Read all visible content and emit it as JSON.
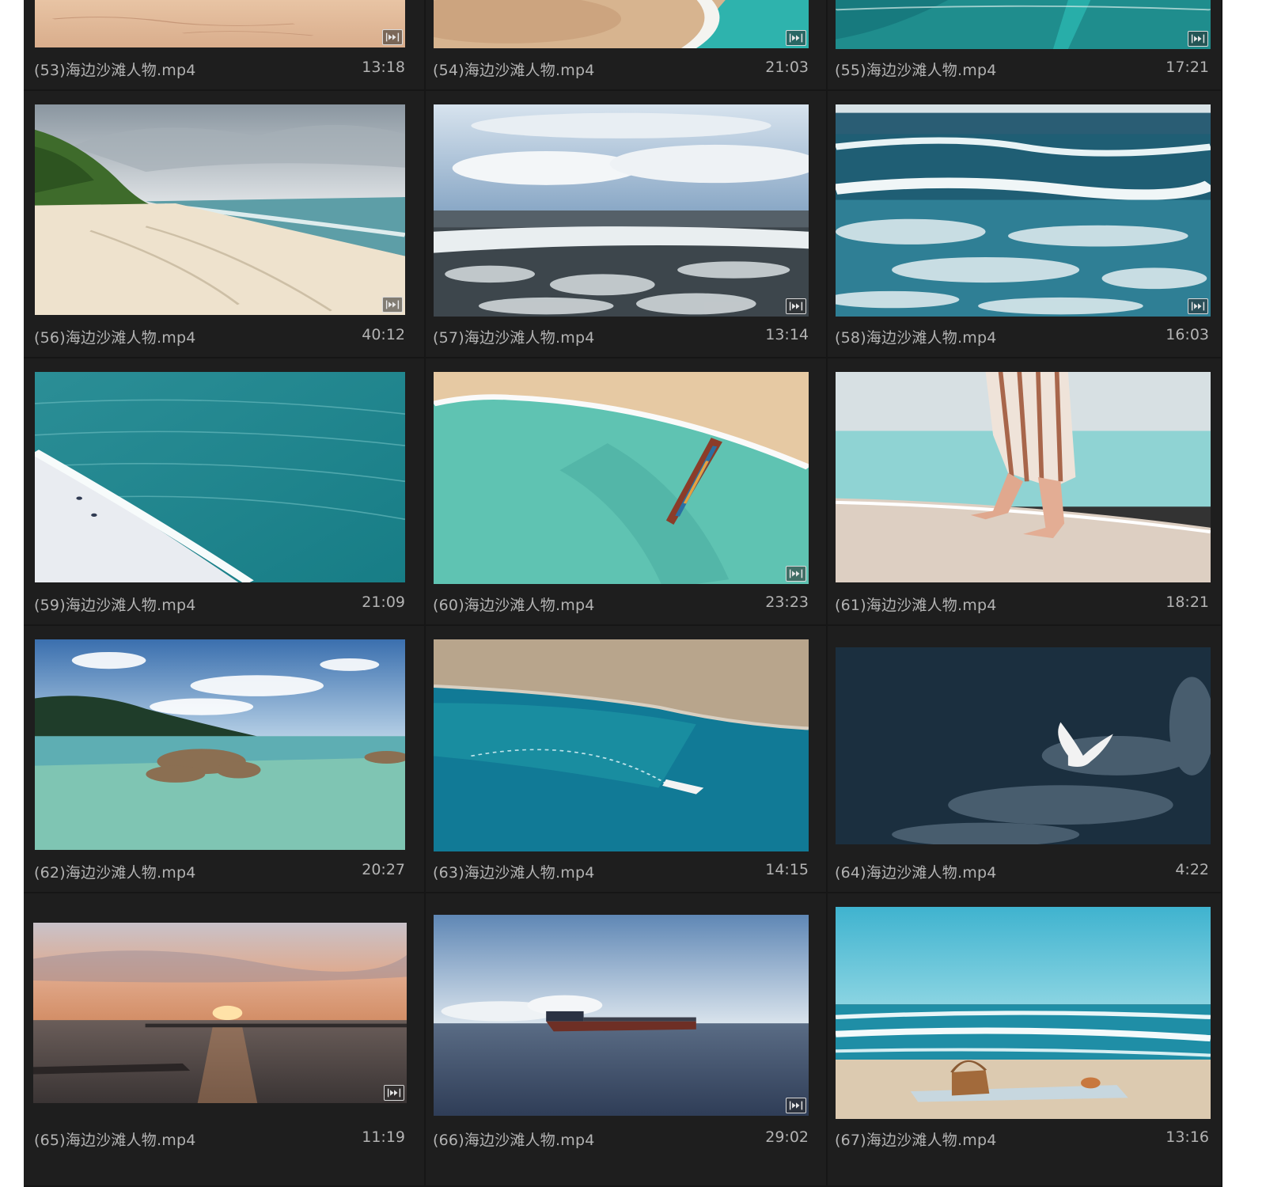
{
  "colors": {
    "panel_bg": "#1d1d1d",
    "text": "#b3b3b3",
    "badge_border": "#d9d9d9"
  },
  "clips": [
    {
      "name": "(53)海边沙滩人物.mp4",
      "duration": "13:18",
      "scene": "sand-closeup",
      "badge": true
    },
    {
      "name": "(54)海边沙滩人物.mp4",
      "duration": "21:03",
      "scene": "sand-wave-aerial",
      "badge": true
    },
    {
      "name": "(55)海边沙滩人物.mp4",
      "duration": "17:21",
      "scene": "teal-wave",
      "badge": true
    },
    {
      "name": "(56)海边沙滩人物.mp4",
      "duration": "40:12",
      "scene": "beach-cliff",
      "badge": true
    },
    {
      "name": "(57)海边沙滩人物.mp4",
      "duration": "13:14",
      "scene": "stormy-sea",
      "badge": true
    },
    {
      "name": "(58)海边沙滩人物.mp4",
      "duration": "16:03",
      "scene": "breaking-waves",
      "badge": true
    },
    {
      "name": "(59)海边沙滩人物.mp4",
      "duration": "21:09",
      "scene": "aerial-teal-sea",
      "badge": false
    },
    {
      "name": "(60)海边沙滩人物.mp4",
      "duration": "23:23",
      "scene": "boat-aerial",
      "badge": true
    },
    {
      "name": "(61)海边沙滩人物.mp4",
      "duration": "18:21",
      "scene": "walking-shore",
      "badge": false
    },
    {
      "name": "(62)海边沙滩人物.mp4",
      "duration": "20:27",
      "scene": "rocky-lagoon",
      "badge": false
    },
    {
      "name": "(63)海边沙滩人物.mp4",
      "duration": "14:15",
      "scene": "speedboat-cliff",
      "badge": false
    },
    {
      "name": "(64)海边沙滩人物.mp4",
      "duration": "4:22",
      "scene": "seagull-dark-sea",
      "badge": false
    },
    {
      "name": "(65)海边沙滩人物.mp4",
      "duration": "11:19",
      "scene": "sunset-harbor",
      "badge": true
    },
    {
      "name": "(66)海边沙滩人物.mp4",
      "duration": "29:02",
      "scene": "cargo-ship",
      "badge": true
    },
    {
      "name": "(67)海边沙滩人物.mp4",
      "duration": "13:16",
      "scene": "picnic-beach",
      "badge": false
    }
  ]
}
